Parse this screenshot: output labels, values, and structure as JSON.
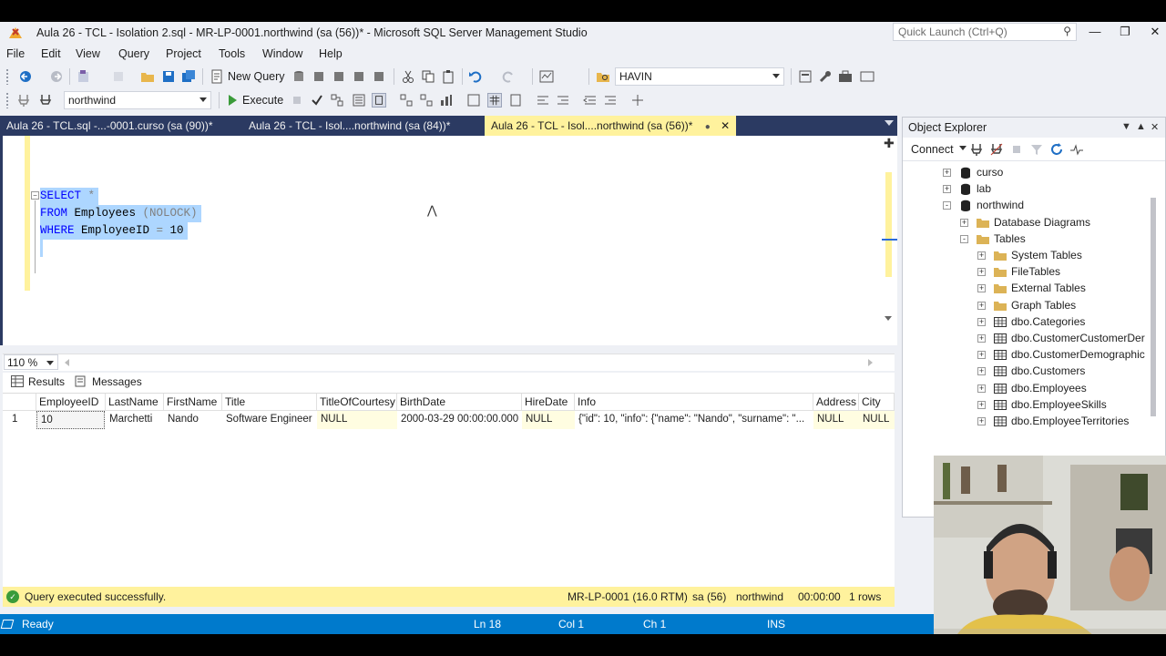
{
  "window": {
    "title": "Aula 26 - TCL - Isolation 2.sql - MR-LP-0001.northwind (sa (56))* - Microsoft SQL Server Management Studio",
    "quick_launch_placeholder": "Quick Launch (Ctrl+Q)"
  },
  "menu": [
    "File",
    "Edit",
    "View",
    "Query",
    "Project",
    "Tools",
    "Window",
    "Help"
  ],
  "toolbar": {
    "new_query_label": "New Query",
    "search_combo_value": "HAVIN",
    "database_combo_value": "northwind",
    "execute_label": "Execute"
  },
  "doc_tabs": [
    {
      "label": "Aula 26 - TCL.sql -...-0001.curso (sa (90))*",
      "active": false
    },
    {
      "label": "Aula 26 - TCL - Isol....northwind (sa (84))*",
      "active": false
    },
    {
      "label": "Aula 26 - TCL - Isol....northwind (sa (56))*",
      "active": true
    }
  ],
  "editor": {
    "lines": {
      "select_kw": "SELECT",
      "select_star": " *",
      "from_kw": "FROM",
      "from_table": " Employees ",
      "from_hint": "(NOLOCK)",
      "where_kw": "WHERE",
      "where_col": " EmployeeID ",
      "where_op": "=",
      "where_val": " 10"
    },
    "zoom": "110 %"
  },
  "results": {
    "tabs": [
      "Results",
      "Messages"
    ],
    "columns": [
      "EmployeeID",
      "LastName",
      "FirstName",
      "Title",
      "TitleOfCourtesy",
      "BirthDate",
      "HireDate",
      "Info",
      "Address",
      "City"
    ],
    "rows": [
      {
        "row_number": "1",
        "cells": [
          "10",
          "Marchetti",
          "Nando",
          "Software Engineer",
          "NULL",
          "2000-03-29 00:00:00.000",
          "NULL",
          "{\"id\": 10, \"info\": {\"name\": \"Nando\", \"surname\": \"...",
          "NULL",
          "NULL"
        ]
      }
    ]
  },
  "query_status": {
    "message": "Query executed successfully.",
    "server": "MR-LP-0001 (16.0 RTM)",
    "user": "sa (56)",
    "database": "northwind",
    "elapsed": "00:00:00",
    "rows": "1 rows"
  },
  "statusbar": {
    "ready": "Ready",
    "ln": "Ln 18",
    "col": "Col 1",
    "ch": "Ch 1",
    "mode": "INS"
  },
  "object_explorer": {
    "title": "Object Explorer",
    "connect_label": "Connect",
    "tree": [
      {
        "label": "curso",
        "icon": "database-icon",
        "level": 0,
        "expander": "+"
      },
      {
        "label": "lab",
        "icon": "database-icon",
        "level": 0,
        "expander": "+"
      },
      {
        "label": "northwind",
        "icon": "database-icon",
        "level": 0,
        "expander": "-"
      },
      {
        "label": "Database Diagrams",
        "icon": "folder-icon",
        "level": 1,
        "expander": "+"
      },
      {
        "label": "Tables",
        "icon": "folder-icon",
        "level": 1,
        "expander": "-"
      },
      {
        "label": "System Tables",
        "icon": "folder-icon",
        "level": 2,
        "expander": "+"
      },
      {
        "label": "FileTables",
        "icon": "folder-icon",
        "level": 2,
        "expander": "+"
      },
      {
        "label": "External Tables",
        "icon": "folder-icon",
        "level": 2,
        "expander": "+"
      },
      {
        "label": "Graph Tables",
        "icon": "folder-icon",
        "level": 2,
        "expander": "+"
      },
      {
        "label": "dbo.Categories",
        "icon": "table-icon",
        "level": 2,
        "expander": "+"
      },
      {
        "label": "dbo.CustomerCustomerDer",
        "icon": "table-icon",
        "level": 2,
        "expander": "+"
      },
      {
        "label": "dbo.CustomerDemographic",
        "icon": "table-icon",
        "level": 2,
        "expander": "+"
      },
      {
        "label": "dbo.Customers",
        "icon": "table-icon",
        "level": 2,
        "expander": "+"
      },
      {
        "label": "dbo.Employees",
        "icon": "table-icon",
        "level": 2,
        "expander": "+"
      },
      {
        "label": "dbo.EmployeeSkills",
        "icon": "table-icon",
        "level": 2,
        "expander": "+"
      },
      {
        "label": "dbo.EmployeeTerritories",
        "icon": "table-icon",
        "level": 2,
        "expander": "+"
      }
    ]
  },
  "colors": {
    "accent": "#007acc",
    "tab_bar": "#2b3a62",
    "active_tab": "#fff29d",
    "selection": "#add6ff",
    "keyword": "#0000ff",
    "success": "#3a9b3a"
  }
}
